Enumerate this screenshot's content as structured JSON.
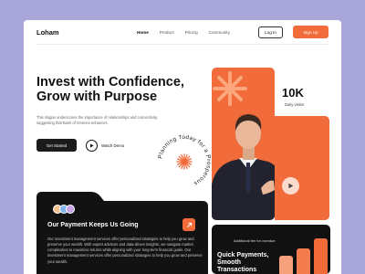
{
  "brand": {
    "logo": "Loham",
    "accent": "#f26b3a",
    "dark": "#111111"
  },
  "nav": {
    "items": [
      "Home",
      "Product",
      "Pricing",
      "Community"
    ],
    "active": "Home"
  },
  "auth": {
    "login_label": "Log In",
    "signup_label": "Sign Up"
  },
  "hero": {
    "title_line1": "Invest with Confidence,",
    "title_line2": "Grow with Purpose",
    "description": "This slogan underscores the importance of relationships and connectivity, suggesting that Bank of America enhances.",
    "cta_primary": "Get Started",
    "cta_secondary": "Watch Demo",
    "badge_text": "Planning Today for a Prosperous"
  },
  "stat": {
    "value": "10K",
    "label": "Daily visitor"
  },
  "payment_card": {
    "title": "Our Payment Keeps Us Going",
    "description": "Our investment management services offer personalized strategies to help you grow and preserve your wealth. With expert advisors and data-driven insights, we navigate market complexities to maximize returns while aligning with your long-term financial goals. Our investment management services offer personalized strategies to help you grow and preserve your wealth."
  },
  "transactions_card": {
    "fee_label": "Additional fee for overdue",
    "title_line1": "Quick Payments,",
    "title_line2": "Smooth",
    "title_line3": "Transactions"
  },
  "icons": [
    "asterisk-icon",
    "play-icon",
    "arrow-up-right-icon",
    "burst-icon"
  ]
}
